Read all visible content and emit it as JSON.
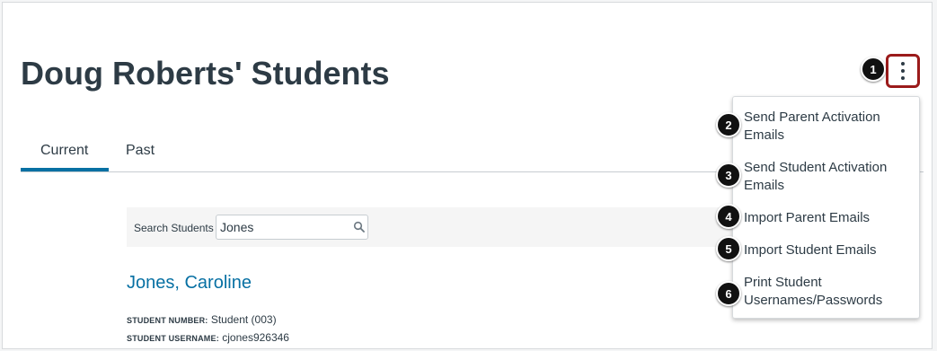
{
  "page_title": "Doug Roberts' Students",
  "tabs": [
    {
      "label": "Current",
      "active": true
    },
    {
      "label": "Past",
      "active": false
    }
  ],
  "search": {
    "label": "Search Students",
    "value": "Jones",
    "icon": "search-icon"
  },
  "student": {
    "name": "Jones, Caroline",
    "number_label": "STUDENT NUMBER:",
    "number_value": "Student (003)",
    "username_label": "STUDENT USERNAME:",
    "username_value": "cjones926346"
  },
  "options_button": {
    "icon": "kebab-menu-icon"
  },
  "menu": {
    "items": [
      {
        "label": "Send Parent Activation Emails"
      },
      {
        "label": "Send Student Activation Emails"
      },
      {
        "label": "Import Parent Emails"
      },
      {
        "label": "Import Student Emails"
      },
      {
        "label": "Print Student Usernames/Passwords"
      }
    ]
  },
  "callouts": [
    "1",
    "2",
    "3",
    "4",
    "5",
    "6"
  ],
  "colors": {
    "accent": "#0770a3",
    "callout_border": "#9b1b1b",
    "text": "#2d3b45"
  }
}
